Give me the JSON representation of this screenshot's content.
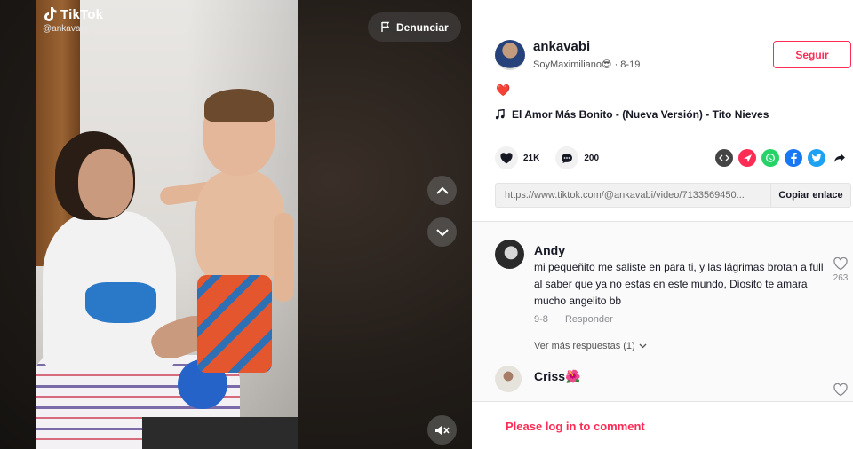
{
  "brand": {
    "name": "TikTok",
    "handle": "@ankavabi"
  },
  "video": {
    "report_label": "Denunciar",
    "nav_up_icon": "chevron-up-icon",
    "nav_down_icon": "chevron-down-icon",
    "mute_icon": "speaker-muted-icon"
  },
  "author": {
    "username": "ankavabi",
    "nickname": "SoyMaximiliano😎",
    "separator": "·",
    "date": "8-19",
    "follow_label": "Seguir"
  },
  "caption": "❤️",
  "music": {
    "title": "El Amor Más Bonito - (Nueva Versión) - Tito Nieves"
  },
  "stats": {
    "likes": "21K",
    "comments": "200"
  },
  "share": {
    "icons": [
      "embed-icon",
      "send-icon",
      "whatsapp-icon",
      "facebook-icon",
      "twitter-icon",
      "share-arrow-icon"
    ],
    "colors": {
      "embed": "#444444",
      "send": "#fe2c55",
      "whatsapp": "#25d366",
      "facebook": "#1877f2",
      "twitter": "#1da1f2"
    }
  },
  "link": {
    "url": "https://www.tiktok.com/@ankavabi/video/7133569450...",
    "copy_label": "Copiar enlace"
  },
  "comments": [
    {
      "user": "Andy",
      "text": "mi pequeñito me saliste en para ti, y las lágrimas brotan a full al saber que ya no estas en este mundo, Diosito te amara mucho angelito bb",
      "date": "9-8",
      "reply_label": "Responder",
      "likes": "263"
    },
    {
      "user": "Criss🌺"
    }
  ],
  "more_replies": "Ver más respuestas (1)",
  "login_prompt": "Please log in to comment",
  "colors": {
    "accent": "#fe2c55",
    "text": "#161823"
  }
}
